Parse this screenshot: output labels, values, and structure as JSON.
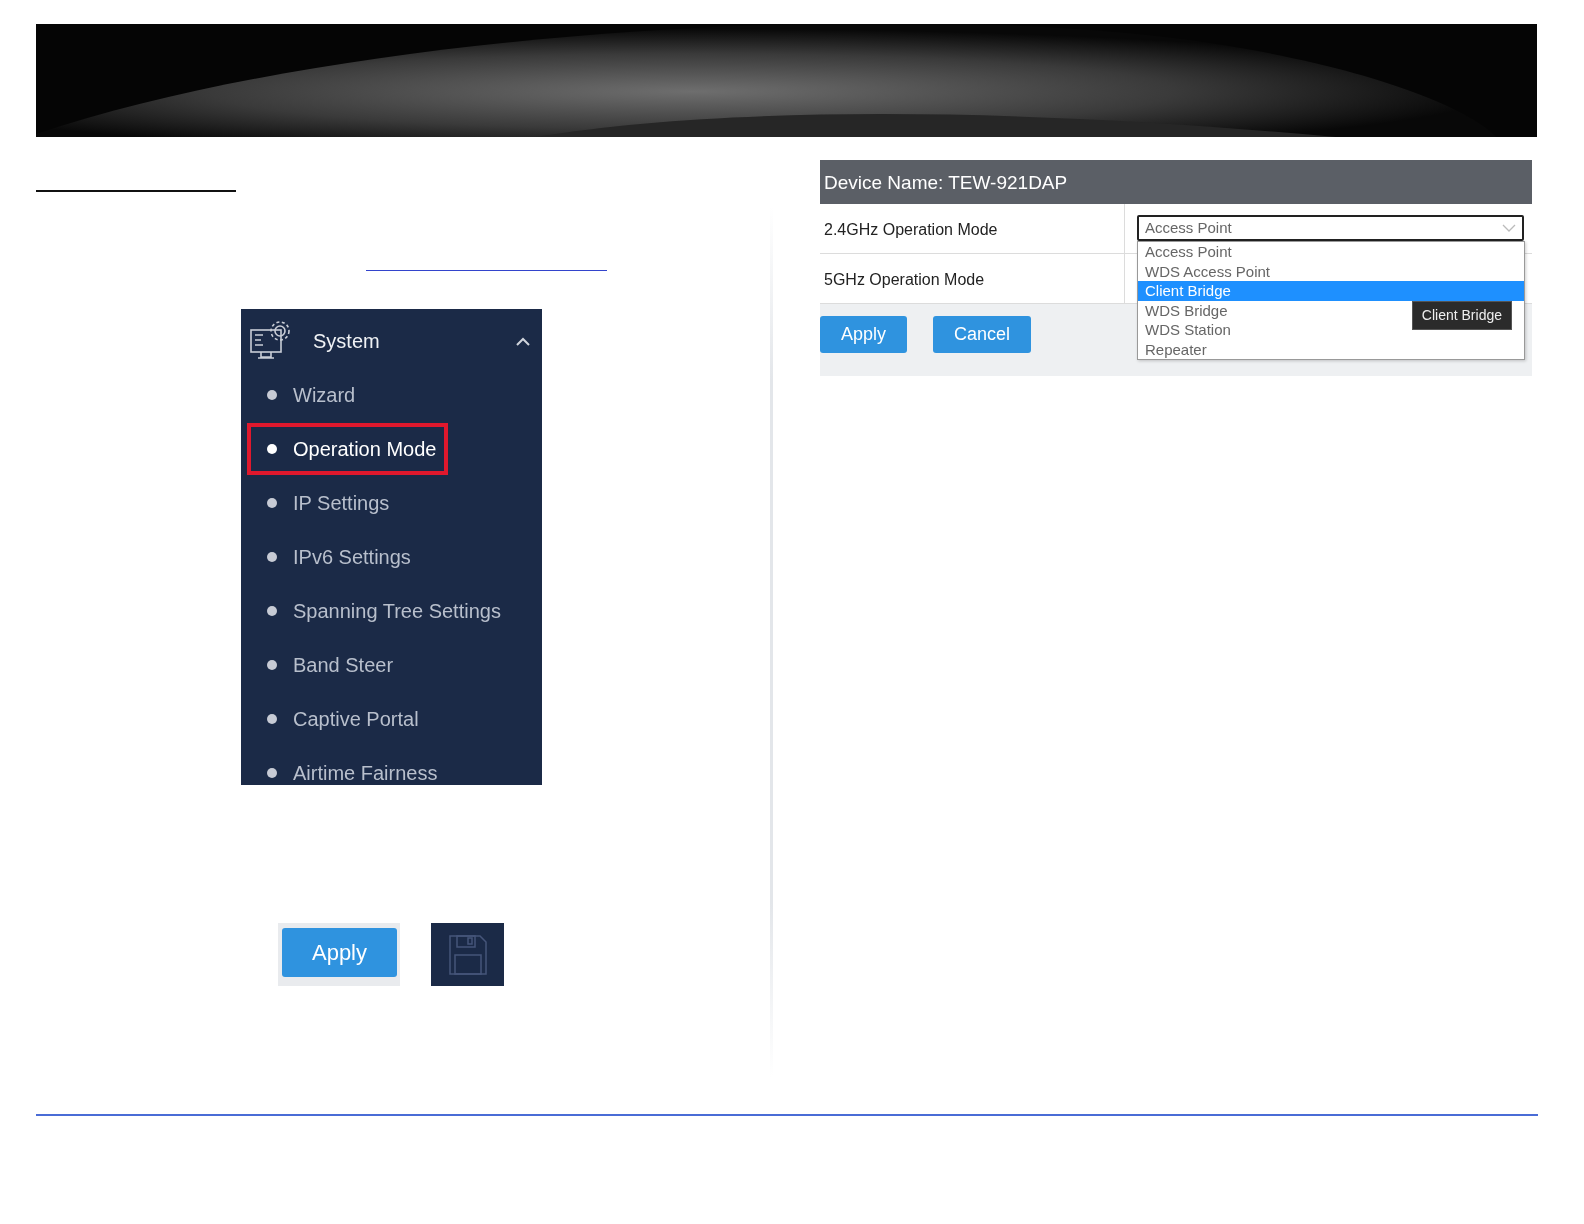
{
  "sidebar": {
    "title": "System",
    "expanded": true,
    "items": [
      {
        "label": "Wizard",
        "selected": false
      },
      {
        "label": "Operation Mode",
        "selected": true
      },
      {
        "label": "IP Settings",
        "selected": false
      },
      {
        "label": "IPv6 Settings",
        "selected": false
      },
      {
        "label": "Spanning Tree Settings",
        "selected": false
      },
      {
        "label": "Band Steer",
        "selected": false
      },
      {
        "label": "Captive Portal",
        "selected": false
      },
      {
        "label": "Airtime Fairness",
        "selected": false
      }
    ]
  },
  "apply_button": "Apply",
  "device_panel": {
    "title": "Device Name: TEW-921DAP",
    "rows": [
      {
        "label": "2.4GHz Operation Mode",
        "value": "Access Point"
      },
      {
        "label": "5GHz Operation Mode"
      }
    ],
    "dropdown": {
      "open": true,
      "options": [
        {
          "label": "Access Point",
          "selected": false
        },
        {
          "label": "WDS Access Point",
          "selected": false
        },
        {
          "label": "Client Bridge",
          "selected": true
        },
        {
          "label": "WDS Bridge",
          "selected": false
        },
        {
          "label": "WDS Station",
          "selected": false
        },
        {
          "label": "Repeater",
          "selected": false
        }
      ]
    },
    "tooltip": "Client Bridge",
    "buttons": [
      "Apply",
      "Cancel"
    ]
  }
}
